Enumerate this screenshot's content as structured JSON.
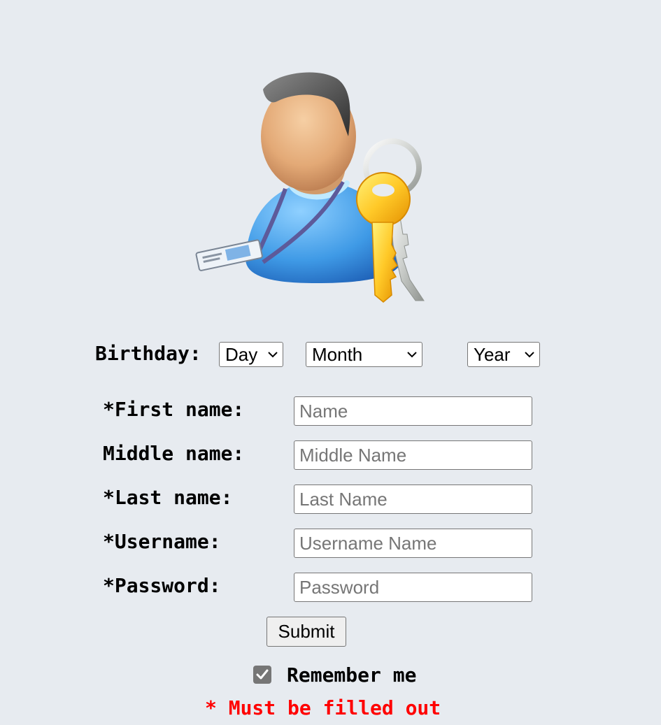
{
  "birthday": {
    "label": "Birthday:",
    "day": "Day",
    "month": "Month",
    "year": "Year"
  },
  "fields": {
    "first_name": {
      "label": "*First name:",
      "placeholder": "Name"
    },
    "middle_name": {
      "label": "Middle name:",
      "placeholder": "Middle Name"
    },
    "last_name": {
      "label": "*Last name:",
      "placeholder": "Last Name"
    },
    "username": {
      "label": "*Username:",
      "placeholder": "Username Name"
    },
    "password": {
      "label": "*Password:",
      "placeholder": "Password"
    }
  },
  "submit_label": "Submit",
  "remember": {
    "label": "Remember me",
    "checked": true
  },
  "required_note": "* Must be filled out",
  "colors": {
    "background": "#e7ebf0",
    "required": "#ff0000"
  },
  "icons": {
    "avatar": "user-with-keys-icon"
  }
}
